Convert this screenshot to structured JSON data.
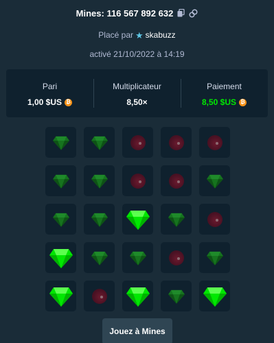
{
  "header": {
    "title": "Mines: 116 567 892 632",
    "placed_by_prefix": "Placé par",
    "username": "skabuzz",
    "activated": "activé 21/10/2022 à 14:19"
  },
  "stats": {
    "bet_label": "Pari",
    "bet_value": "1,00 $US",
    "multiplier_label": "Multiplicateur",
    "multiplier_value": "8,50×",
    "payout_label": "Paiement",
    "payout_value": "8,50 $US"
  },
  "colors": {
    "background": "#1a2c38",
    "panel": "#0f212e",
    "gem_green": "#00e701",
    "payout_green": "#00e701",
    "mine_red": "#5a1428",
    "coin_orange": "#f7931a"
  },
  "board": [
    [
      "gem",
      "gem",
      "mine",
      "mine",
      "mine"
    ],
    [
      "gem",
      "gem",
      "mine",
      "mine",
      "gem"
    ],
    [
      "gem",
      "gem",
      "gem-revealed",
      "gem",
      "mine"
    ],
    [
      "gem-revealed",
      "gem",
      "gem",
      "mine",
      "gem"
    ],
    [
      "gem-revealed",
      "mine",
      "gem-revealed",
      "gem",
      "gem-revealed"
    ]
  ],
  "icons": {
    "copy": "copy-icon",
    "link": "link-icon",
    "user_badge": "star-icon",
    "currency": "bitcoin-icon"
  },
  "play_button": "Jouez à Mines"
}
